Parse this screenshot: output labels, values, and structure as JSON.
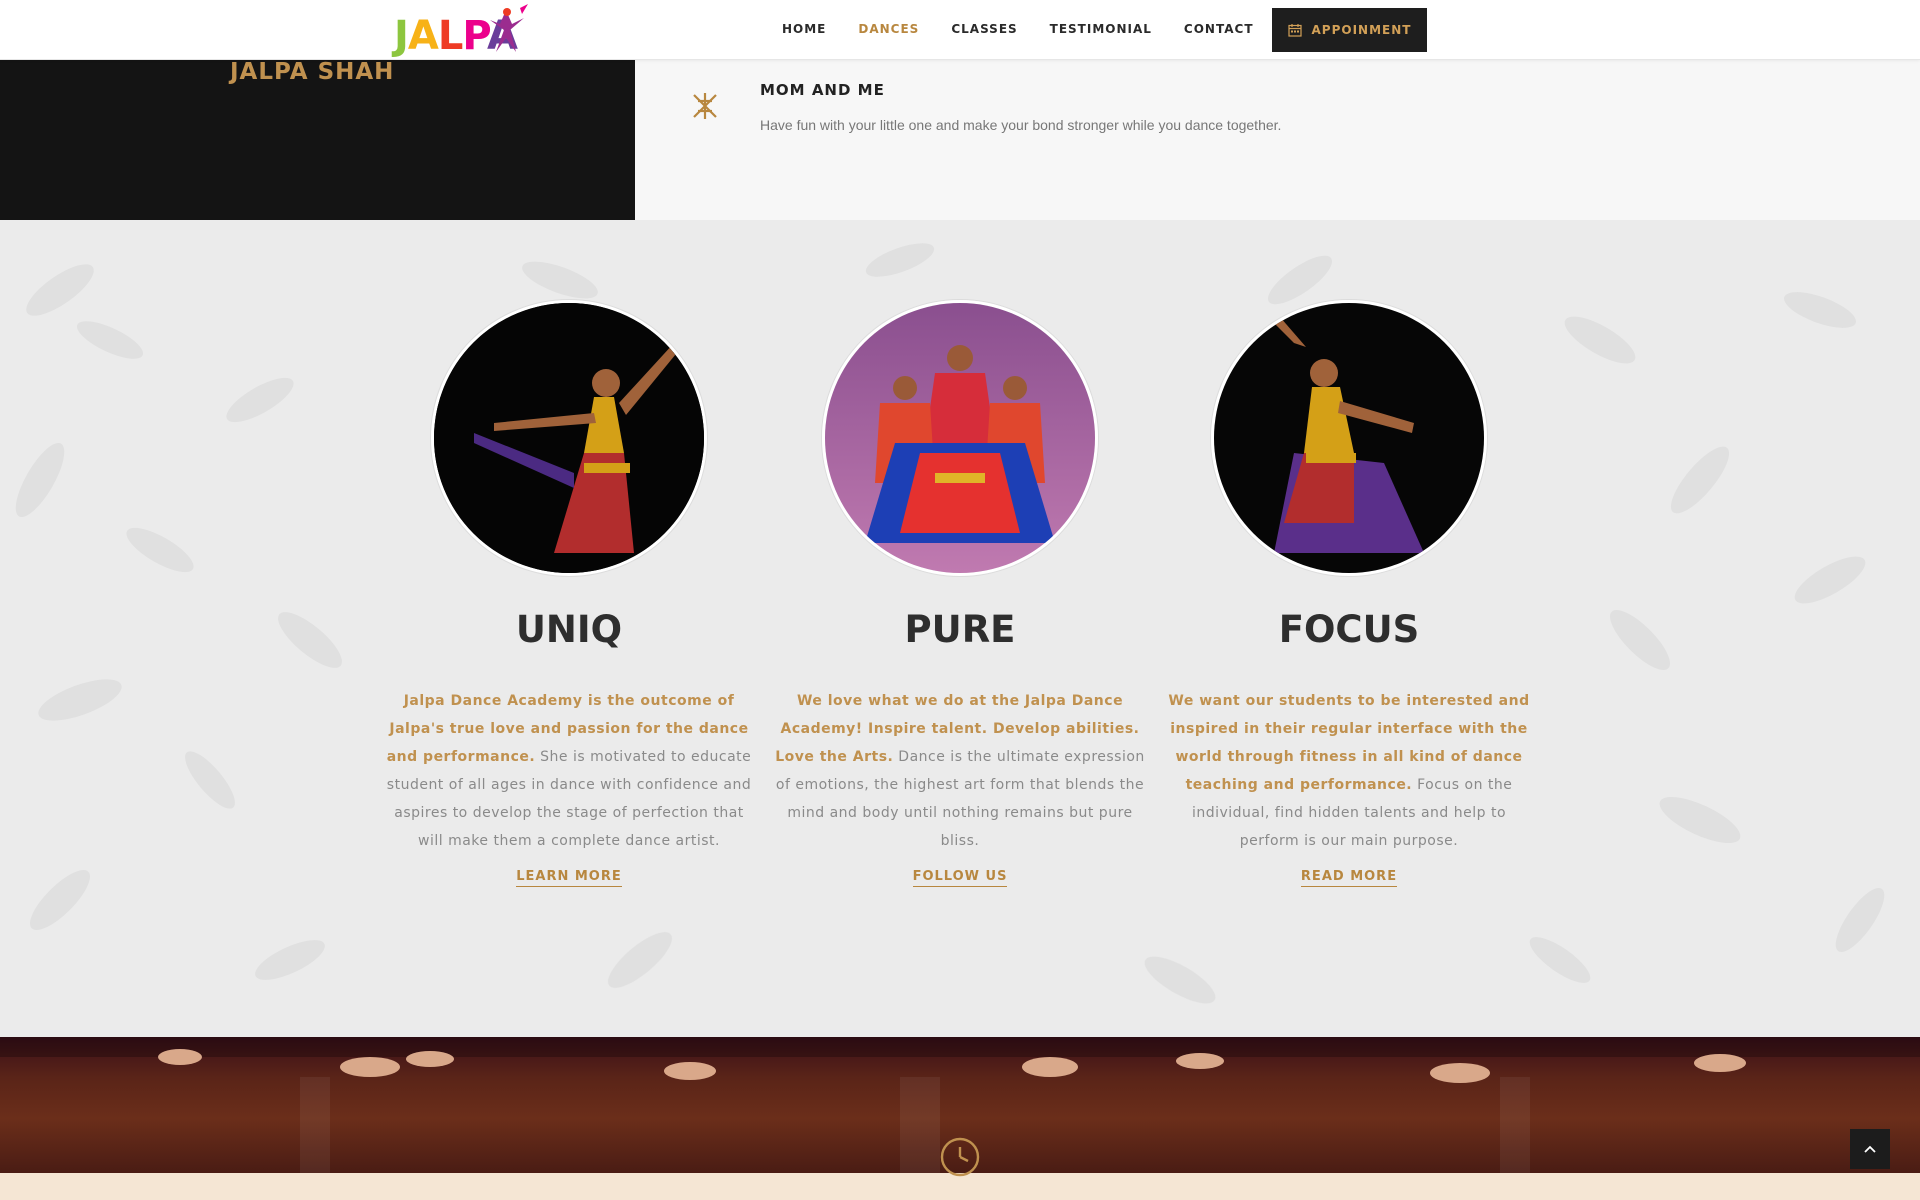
{
  "header": {
    "logo_text": "JALPA",
    "nav": [
      {
        "label": "HOME"
      },
      {
        "label": "DANCES"
      },
      {
        "label": "CLASSES"
      },
      {
        "label": "TESTIMONIAL"
      },
      {
        "label": "CONTACT"
      }
    ],
    "active_nav": "DANCES",
    "appointment_label": "APPOINMENT",
    "appointment_icon": "calendar-icon"
  },
  "top_band": {
    "dark_title": "JALPA SHAH",
    "item_icon": "asterisk-pattern-icon",
    "item_title": "MOM AND ME",
    "item_text": "Have fun with your little one and make your bond stronger while you dance together."
  },
  "features": [
    {
      "title": "UNIQ",
      "highlight": "Jalpa Dance Academy is the outcome of Jalpa's true love and passion for the dance and performance.",
      "body": " She is motivated to educate student of all ages in dance with confidence and aspires to develop the stage of perfection that will make them a complete dance artist.",
      "link": "LEARN MORE"
    },
    {
      "title": "PURE",
      "highlight": "We love what we do at the Jalpa Dance Academy! Inspire talent. Develop abilities. Love the Arts.",
      "body": " Dance is the ultimate expression of emotions, the highest art form that blends the mind and body until nothing remains but pure bliss.",
      "link": "FOLLOW US"
    },
    {
      "title": "FOCUS",
      "highlight": "We want our students to be interested and inspired in their regular interface with the world through fitness in all kind of dance teaching and performance.",
      "body": " Focus on the individual, find hidden talents and help to perform is our main purpose.",
      "link": "READ MORE"
    }
  ],
  "colors": {
    "accent": "#b8873f",
    "dark": "#141414",
    "heading": "#2e2e2e",
    "body_text": "#8a8a8a",
    "stage_floor": "#6b2e1a",
    "cream": "#f5e6d4"
  },
  "icons": {
    "clock": "clock-icon",
    "scroll_top": "chevron-up-icon"
  }
}
